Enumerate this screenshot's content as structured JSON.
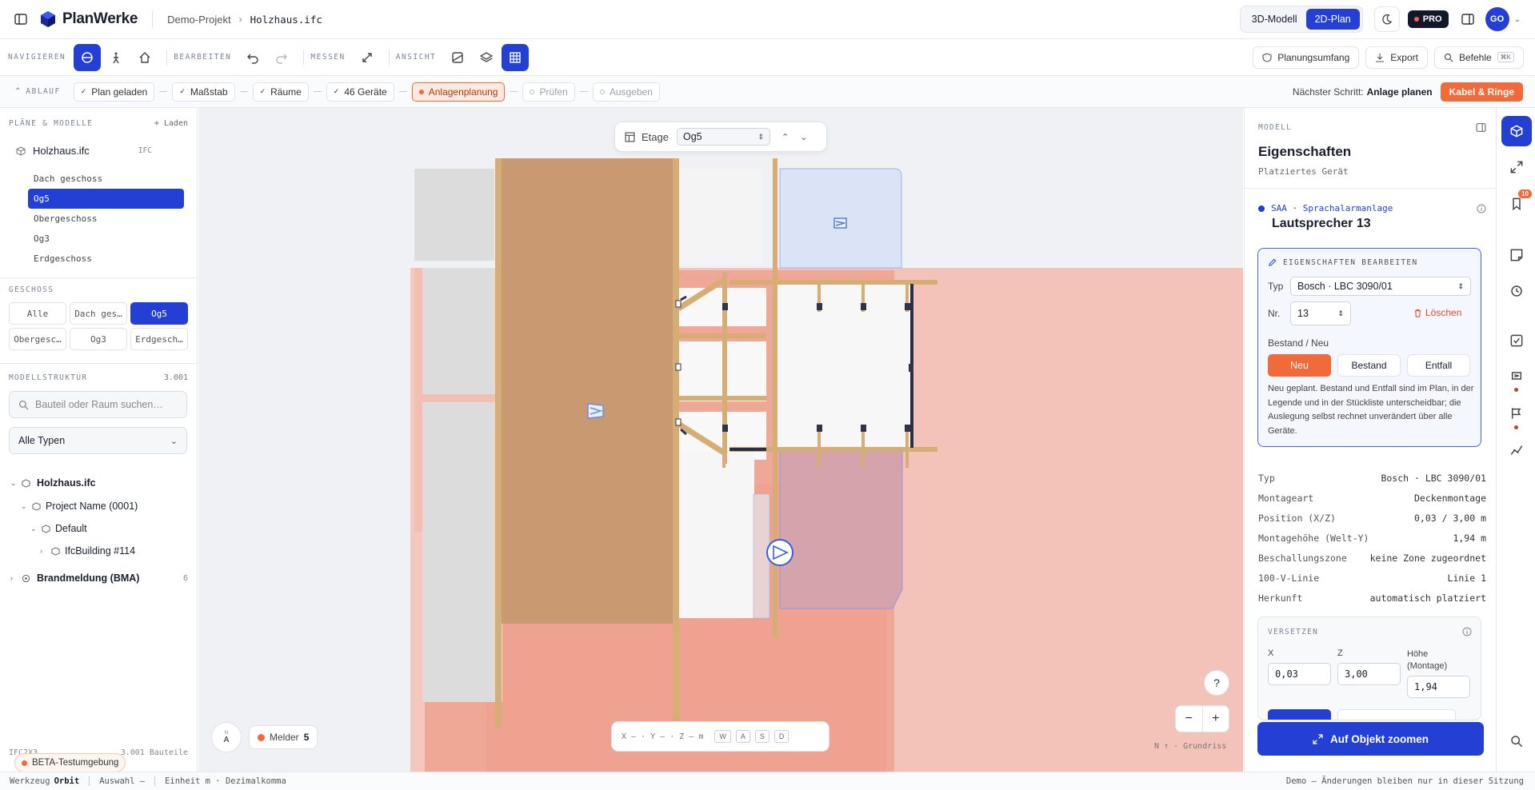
{
  "topbar": {
    "brand": "PlanWerke",
    "crumb_project": "Demo-Projekt",
    "crumb_file": "Holzhaus.ifc",
    "view_3d": "3D-Modell",
    "view_2d": "2D-Plan",
    "pro_badge": "PRO",
    "avatar": "GO"
  },
  "toolbar": {
    "navigate": "NAVIGIEREN",
    "edit": "BEARBEITEN",
    "measure": "MESSEN",
    "view": "ANSICHT",
    "scope_btn": "Planungsumfang",
    "export_btn": "Export",
    "commands_btn": "Befehle",
    "commands_kbd": "⌘K"
  },
  "flow": {
    "label": "ABLAUF",
    "steps": [
      "Plan geladen",
      "Maßstab",
      "Räume",
      "46 Geräte",
      "Anlagenplanung",
      "Prüfen",
      "Ausgeben"
    ],
    "next_label": "Nächster Schritt:",
    "next_value": "Anlage planen",
    "cta": "Kabel & Ringe"
  },
  "left": {
    "plans_title": "PLÄNE & MODELLE",
    "load": "+ Laden",
    "file": "Holzhaus.ifc",
    "file_type": "IFC",
    "floors": [
      "Dach geschoss",
      "Og5",
      "Obergeschoss",
      "Og3",
      "Erdgeschoss"
    ],
    "geschoss_title": "GESCHOSS",
    "geschoss_btns": [
      "Alle",
      "Dach ges…",
      "Og5",
      "Obergesc…",
      "Og3",
      "Erdgesch…"
    ],
    "struct_title": "MODELLSTRUKTUR",
    "struct_count": "3.001",
    "search_placeholder": "Bauteil oder Raum suchen…",
    "type_select": "Alle Typen",
    "tree": [
      "Holzhaus.ifc",
      "Project Name (0001)",
      "Default",
      "IfcBuilding #114",
      "Brandmeldung (BMA)"
    ],
    "bma_count": "6",
    "footer_left": "IFC2X3",
    "footer_right": "3.001 Bauteile",
    "beta": "BETA-Testumgebung"
  },
  "canvas": {
    "etage_label": "Etage",
    "etage_value": "Og5",
    "melder_label": "Melder",
    "melder_count": "5",
    "compass": "N",
    "coords": "X — · Y — · Z — m",
    "keys": [
      "W",
      "A",
      "S",
      "D"
    ],
    "help": "?",
    "zoom_out": "−",
    "zoom_in": "+",
    "orientation": "N ↑ · Grundriss"
  },
  "right": {
    "section": "MODELL",
    "title": "Eigenschaften",
    "subtitle": "Platziertes Gerät",
    "device_tag": "SAA · Sprachalarmanlage",
    "device_name": "Lautsprecher 13",
    "edit_title": "EIGENSCHAFTEN BEARBEITEN",
    "typ_label": "Typ",
    "typ_value": "Bosch · LBC 3090/01",
    "nr_label": "Nr.",
    "nr_value": "13",
    "delete": "Löschen",
    "bestand_label": "Bestand / Neu",
    "opt_neu": "Neu",
    "opt_bestand": "Bestand",
    "opt_entfall": "Entfall",
    "note": "Neu geplant. Bestand und Entfall sind im Plan, in der Legende und in der Stückliste unterscheidbar; die Auslegung selbst rechnet unverändert über alle Geräte.",
    "props": [
      {
        "k": "Typ",
        "v": "Bosch · LBC 3090/01"
      },
      {
        "k": "Montageart",
        "v": "Deckenmontage"
      },
      {
        "k": "Position (X/Z)",
        "v": "0,03 / 3,00 m"
      },
      {
        "k": "Montagehöhe (Welt-Y)",
        "v": "1,94 m"
      },
      {
        "k": "Beschallungszone",
        "v": "keine Zone zugeordnet"
      },
      {
        "k": "100-V-Linie",
        "v": "Linie 1"
      },
      {
        "k": "Herkunft",
        "v": "automatisch platziert"
      }
    ],
    "move_title": "VERSETZEN",
    "x_label": "X",
    "z_label": "Z",
    "h_label": "Höhe (Montage)",
    "x_value": "0,03",
    "z_value": "3,00",
    "h_value": "1,94",
    "zoom_btn": "Auf Objekt zoomen"
  },
  "rail": {
    "badge": "10"
  },
  "status": {
    "tool_label": "Werkzeug",
    "tool_value": "Orbit",
    "selection": "Auswahl —",
    "units": "Einheit m · Dezimalkomma",
    "demo": "Demo — Änderungen bleiben nur in dieser Sitzung"
  },
  "colors": {
    "accent": "#2440d4",
    "orange": "#f06a3a"
  }
}
